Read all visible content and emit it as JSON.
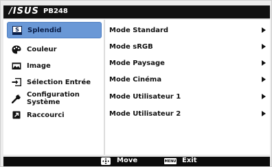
{
  "header": {
    "logo_text": "/ISUS",
    "model": "PB248"
  },
  "sidebar": {
    "items": [
      {
        "label": "Splendid",
        "icon": "splendid-s-icon",
        "active": true
      },
      {
        "label": "Couleur",
        "icon": "palette-icon",
        "active": false
      },
      {
        "label": "Image",
        "icon": "image-icon",
        "active": false
      },
      {
        "label": "Sélection Entrée",
        "icon": "input-select-icon",
        "active": false
      },
      {
        "label": "Configuration Système",
        "icon": "wrench-icon",
        "active": false
      },
      {
        "label": "Raccourci",
        "icon": "shortcut-icon",
        "active": false
      }
    ]
  },
  "options": {
    "items": [
      {
        "label": "Mode Standard"
      },
      {
        "label": "Mode sRGB"
      },
      {
        "label": "Mode Paysage"
      },
      {
        "label": "Mode Cinéma"
      },
      {
        "label": "Mode Utilisateur 1"
      },
      {
        "label": "Mode Utilisateur 2"
      }
    ]
  },
  "footer": {
    "move_label": "Move",
    "menu_key": "MENU",
    "exit_label": "Exit"
  },
  "colors": {
    "active_highlight": "#6a98d6",
    "bar_background": "#111111"
  }
}
